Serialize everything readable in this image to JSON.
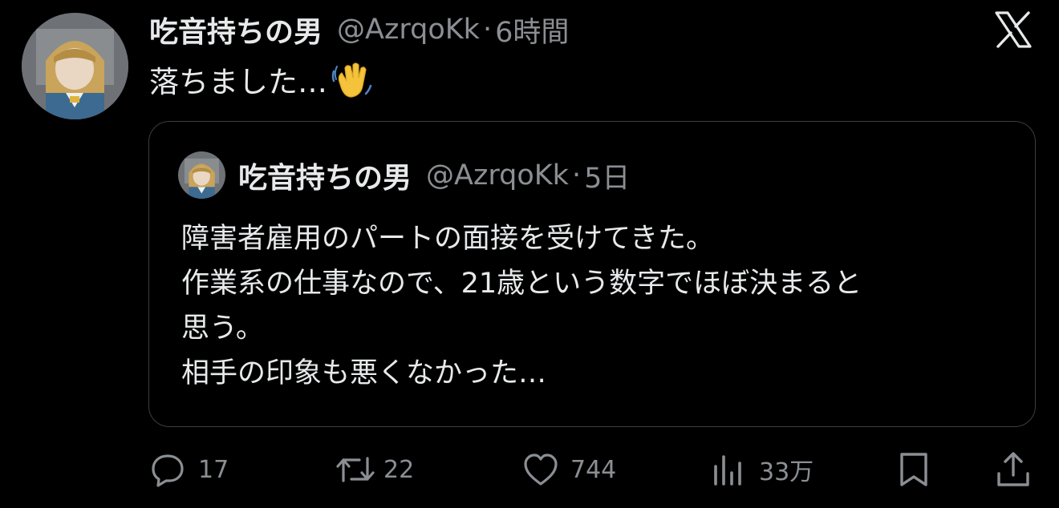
{
  "tweet": {
    "display_name": "吃音持ちの男",
    "handle": "@AzrqoKk",
    "separator": "·",
    "time": "6時間",
    "text": "落ちました…",
    "emoji_icon": "waving-hand-icon"
  },
  "quoted": {
    "display_name": "吃音持ちの男",
    "handle": "@AzrqoKk",
    "separator": "·",
    "time": "5日",
    "lines": [
      "障害者雇用のパートの面接を受けてきた。",
      "作業系の仕事なので、21歳という数字でほぼ決まると",
      "思う。",
      "相手の印象も悪くなかった…"
    ]
  },
  "actions": {
    "reply_count": "17",
    "repost_count": "22",
    "like_count": "744",
    "views_count": "33万"
  },
  "icons": {
    "brand": "x-logo-icon",
    "reply": "reply-icon",
    "repost": "repost-icon",
    "like": "heart-icon",
    "views": "views-chart-icon",
    "bookmark": "bookmark-icon",
    "share": "share-icon"
  },
  "colors": {
    "background": "#000000",
    "primary_text": "#e7e9ea",
    "secondary_text": "#8b8f94",
    "card_border": "#3a3d41"
  }
}
